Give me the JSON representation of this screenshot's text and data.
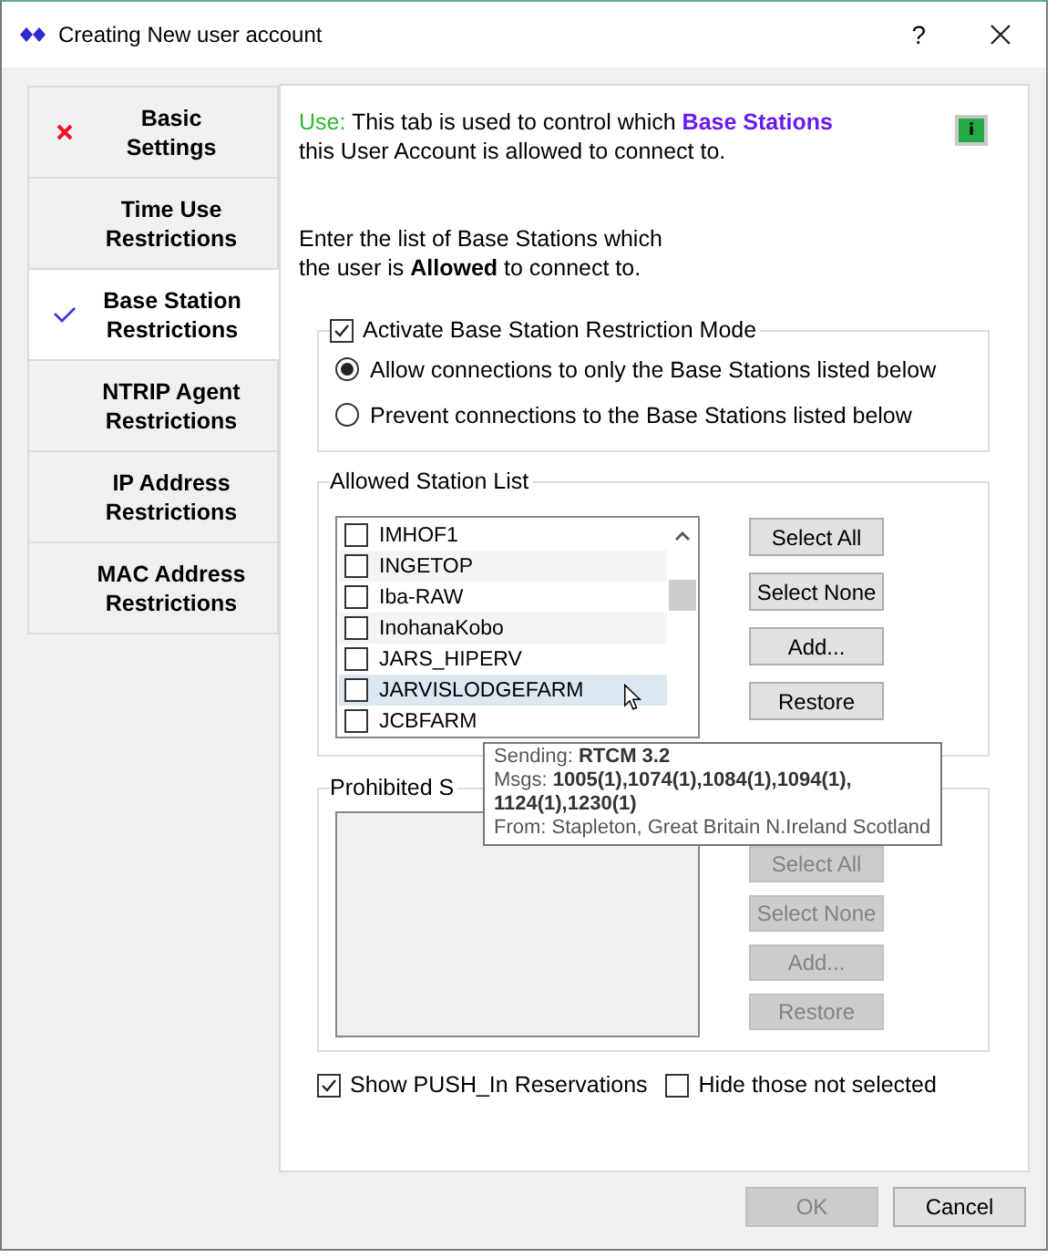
{
  "window": {
    "title": "Creating New user account",
    "help": "?"
  },
  "tabs": [
    {
      "label": "Basic\nSettings",
      "error": true,
      "complete": false,
      "selected": false
    },
    {
      "label": "Time Use\nRestrictions",
      "error": false,
      "complete": false,
      "selected": false
    },
    {
      "label": "Base Station\nRestrictions",
      "error": false,
      "complete": true,
      "selected": true
    },
    {
      "label": "NTRIP Agent\nRestrictions",
      "error": false,
      "complete": false,
      "selected": false
    },
    {
      "label": "IP Address\nRestrictions",
      "error": false,
      "complete": false,
      "selected": false
    },
    {
      "label": "MAC Address\nRestrictions",
      "error": false,
      "complete": false,
      "selected": false
    }
  ],
  "usage": {
    "label": "Use:",
    "text": "This tab is used to control which **Base Stations**\nthis User Account is allowed to connect to.",
    "info": "i"
  },
  "instructions": "Enter the list of Base Stations which\nthe user is **Allowed** to connect to.",
  "restriction_mode": {
    "label": "Activate Base Station Restriction Mode",
    "checked": true,
    "options": [
      {
        "label": "Allow connections to only the Base Stations listed below",
        "selected": true
      },
      {
        "label": "Prevent connections to the Base Stations listed below",
        "selected": false
      }
    ]
  },
  "allowed_list": {
    "title": "Allowed Station List",
    "disabled": false,
    "stations": [
      {
        "name": "IMHOF1",
        "checked": false,
        "hovered": false
      },
      {
        "name": "INGETOP",
        "checked": false,
        "hovered": false
      },
      {
        "name": "Iba-RAW",
        "checked": false,
        "hovered": false
      },
      {
        "name": "InohanaKobo",
        "checked": false,
        "hovered": false
      },
      {
        "name": "JARS_HIPERV",
        "checked": false,
        "hovered": false
      },
      {
        "name": "JARVISLODGEFARM",
        "checked": false,
        "hovered": true
      },
      {
        "name": "JCBFARM",
        "checked": false,
        "hovered": false
      }
    ],
    "buttons": [
      {
        "label": "Select All",
        "disabled": false
      },
      {
        "label": "Select None",
        "disabled": false
      },
      {
        "label": "Add...",
        "disabled": false
      },
      {
        "label": "Restore",
        "disabled": false
      }
    ]
  },
  "prohibited_list": {
    "title": "Prohibited S",
    "disabled": true,
    "buttons": [
      {
        "label": "Select All",
        "disabled": true
      },
      {
        "label": "Select None",
        "disabled": true
      },
      {
        "label": "Add...",
        "disabled": true
      },
      {
        "label": "Restore",
        "disabled": true
      }
    ]
  },
  "tooltip": {
    "lines": [
      "Sending: **RTCM 3.2**",
      "Msgs: **1005(1),1074(1),1084(1),1094(1),\n1124(1),1230(1)**",
      "From: Stapleton, Great Britain N.Ireland Scotland"
    ]
  },
  "options": [
    {
      "label": "Show PUSH_In Reservations",
      "checked": true
    },
    {
      "label": "Hide those not selected",
      "checked": false
    }
  ],
  "footer_buttons": [
    {
      "label": "OK",
      "disabled": true
    },
    {
      "label": "Cancel",
      "disabled": false
    }
  ]
}
